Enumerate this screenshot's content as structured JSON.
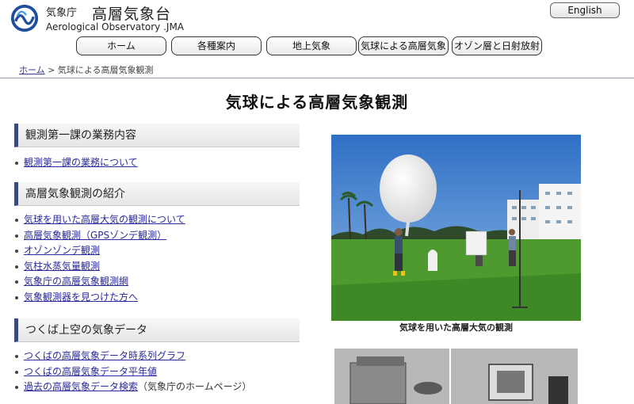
{
  "header": {
    "agency": "気象庁",
    "title": "高層気象台",
    "subtitle": "Aerological Observatory .JMA",
    "lang_button": "English"
  },
  "nav": [
    {
      "label": "ホーム"
    },
    {
      "label": "各種案内"
    },
    {
      "label": "地上気象"
    },
    {
      "label": "気球による高層気象"
    },
    {
      "label": "オゾン層と日射放射"
    }
  ],
  "breadcrumb": {
    "home": "ホーム",
    "separator": ">",
    "current": "気球による高層気象観測"
  },
  "page": {
    "title": "気球による高層気象観測"
  },
  "sections": [
    {
      "heading": "観測第一課の業務内容",
      "links": [
        "観測第一課の業務について"
      ]
    },
    {
      "heading": "高層気象観測の紹介",
      "links": [
        "気球を用いた高層大気の観測について",
        "高層気象観測（GPSゾンデ観測）",
        "オゾンゾンデ観測",
        "気柱水蒸気量観測",
        "気象庁の高層気象観測網",
        "気象観測器を見つけた方へ"
      ]
    },
    {
      "heading": "つくば上空の気象データ",
      "links": [
        "つくばの高層気象データ時系列グラフ",
        "つくばの高層気象データ平年値",
        "過去の高層気象データ検索"
      ],
      "note": "（気象庁のホームページ）"
    }
  ],
  "photo": {
    "caption": "気球を用いた高層大気の観測"
  },
  "colors": {
    "accent": "#3a4a7c",
    "link": "#2a2a9a"
  }
}
